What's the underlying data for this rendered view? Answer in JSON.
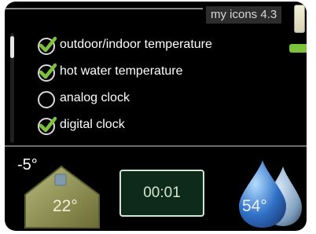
{
  "header": {
    "title": "my icons 4.3"
  },
  "options": [
    {
      "label": "outdoor/indoor temperature",
      "checked": true
    },
    {
      "label": "hot water temperature",
      "checked": true
    },
    {
      "label": "analog clock",
      "checked": false
    },
    {
      "label": "digital clock",
      "checked": true
    }
  ],
  "status": {
    "outdoor_temp": "-5°",
    "indoor_temp": "22°",
    "clock_time": "00:01",
    "hot_water_temp": "54°"
  },
  "colors": {
    "screen_bg": "#000000",
    "check_green": "#7cc33a",
    "house_olive": "#8a8a45",
    "clock_green": "#0e2a1b",
    "water_blue": "#2f6fc5"
  },
  "icons": {
    "battery": "battery-icon",
    "check": "checkbox-checked-icon",
    "empty_check": "checkbox-empty-icon",
    "house": "house-icon",
    "water": "water-drop-icon"
  }
}
